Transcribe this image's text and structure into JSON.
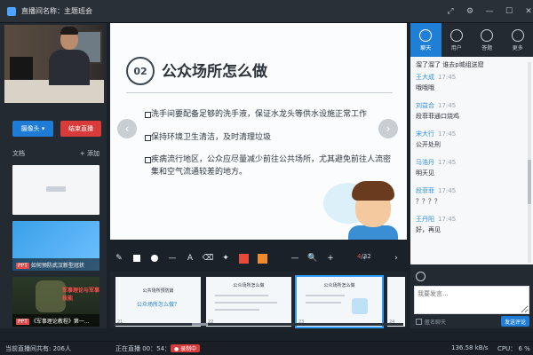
{
  "window": {
    "title": "直播间名称：主题班会",
    "controls": [
      "⤢",
      "⚙",
      "—",
      "☐",
      "✕"
    ]
  },
  "left": {
    "camera_button": "摄像头 ▾",
    "end_button": "结束直播",
    "docs_label": "文档",
    "add_label": "+ 添加",
    "docs": [
      {
        "name": ""
      },
      {
        "name": "如何预防武汉新型冠状",
        "tag": "PPT"
      },
      {
        "name": "《军事理论教程》第一...",
        "tag": "PPT",
        "overlay": "军事理论与军事技能"
      }
    ]
  },
  "slide": {
    "number": "02",
    "heading": "公众场所怎么做",
    "bullets": [
      "洗手间要配备足够的洗手液，保证水龙头等供水设施正常工作",
      "保持环境卫生清洁，及时清理垃圾",
      "疾病流行地区，公众应尽量减少前往公共场所，尤其避免前往人流密集和空气流通较差的地方。"
    ],
    "prev_arrow": "‹",
    "next_arrow": "›"
  },
  "toolbar": {
    "tools": [
      "✎",
      "A",
      "⌫",
      "✦",
      "—",
      "🔍",
      "+",
      "‹",
      "›"
    ],
    "page_current": "4",
    "page_total": "/32",
    "colors": [
      "#e84a3a",
      "#f08a2c"
    ]
  },
  "thumbnails": [
    {
      "title": "公共场所预防篇",
      "subtitle": "公众场所怎么做？",
      "num": "21"
    },
    {
      "title": "公众场所怎么做",
      "num": "22"
    },
    {
      "title": "公众场所怎么做",
      "num": "23"
    },
    {
      "title": "",
      "num": "24"
    }
  ],
  "right": {
    "tabs": [
      "聊天",
      "用户",
      "答题",
      "更多"
    ],
    "messages": [
      {
        "name": "",
        "time": "",
        "text": "溜了溜了  谁去p城组送窟"
      },
      {
        "name": "王大成",
        "time": "17:45",
        "text": "哦哦哦"
      },
      {
        "name": "刘益合",
        "time": "17:45",
        "text": "段菲菲通口烧鸡"
      },
      {
        "name": "宋大行",
        "time": "17:45",
        "text": "公开处刑"
      },
      {
        "name": "马浩丹",
        "time": "17:45",
        "text": "明天见"
      },
      {
        "name": "段菲菲",
        "time": "17:45",
        "text": "？？？？"
      },
      {
        "name": "王丹阳",
        "time": "17:45",
        "text": "好，再见"
      }
    ],
    "input_placeholder": "我要发言...",
    "anon_label": "匿名聊天",
    "send_label": "发送评论"
  },
  "status": {
    "online": "当前直播间共有: 206人",
    "live_time": "正在直播 00：54：42",
    "record": "● 录制中",
    "speed": "136.58 kB/s",
    "cpu": "CPU： 6 %"
  },
  "colors": {
    "accent": "#1e7cd6",
    "danger": "#d93a3a",
    "bg": "#1b2128"
  }
}
